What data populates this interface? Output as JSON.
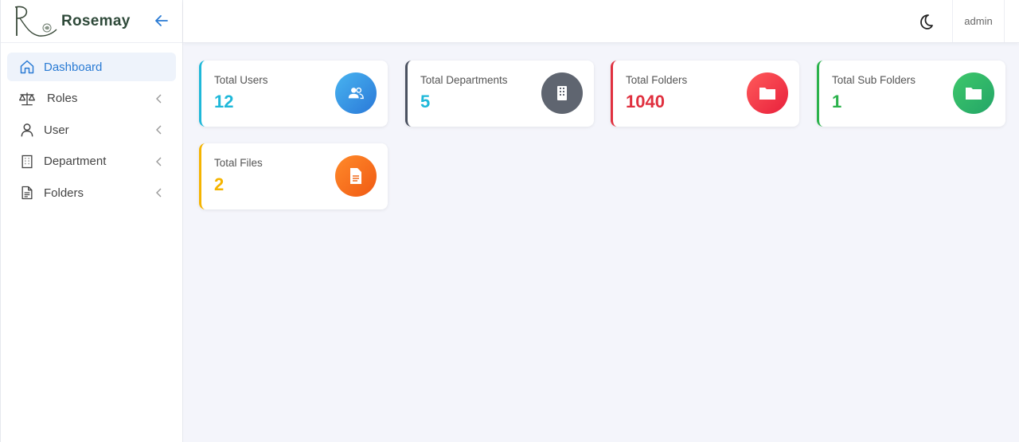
{
  "brand": {
    "name": "Rosemay"
  },
  "sidebar": {
    "items": [
      {
        "label": "Dashboard",
        "icon": "home-icon",
        "active": true
      },
      {
        "label": "Roles",
        "icon": "scale-icon"
      },
      {
        "label": "User",
        "icon": "user-icon"
      },
      {
        "label": "Department",
        "icon": "building-icon"
      },
      {
        "label": "Folders",
        "icon": "document-icon"
      }
    ]
  },
  "topbar": {
    "user_label": "admin",
    "theme_icon": "moon-icon"
  },
  "cards": [
    {
      "title": "Total Users",
      "value": "12",
      "color": "#1fb8d9",
      "icon": "users-icon"
    },
    {
      "title": "Total Departments",
      "value": "5",
      "color": "#4a5160",
      "icon": "building-icon"
    },
    {
      "title": "Total Folders",
      "value": "1040",
      "color": "#e0303f",
      "icon": "folder-icon"
    },
    {
      "title": "Total Sub Folders",
      "value": "1",
      "color": "#2bb24c",
      "icon": "folder-icon"
    },
    {
      "title": "Total Files",
      "value": "2",
      "color": "#f5b400",
      "icon": "file-icon"
    }
  ]
}
